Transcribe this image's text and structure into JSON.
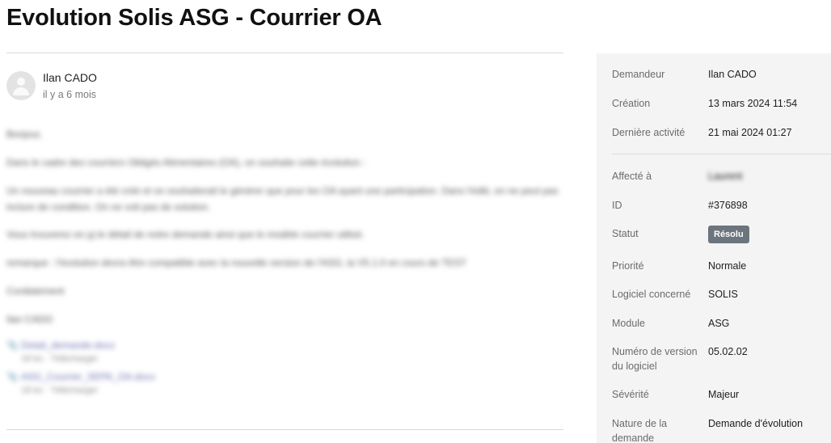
{
  "page": {
    "title": "Evolution Solis ASG - Courrier OA"
  },
  "post": {
    "author": "Ilan CADO",
    "time": "il y a 6 mois",
    "paragraphs": [
      "Bonjour,",
      "Dans le cadre des courriers Obligés Alimentaires (OA), on souhaite cette évolution :",
      "Un nouveau courrier a été créé et on souhaiterait le générer que pour les OA ayant une participation. Dans l'éditi, on ne peut pas inclure de condition. On ne voit pas de solution.",
      "Vous trouverez en pj le détail de notre demande ainsi que le modèle courrier utilisé.",
      "remarque : l'évolution devra être compatible avec la nouvelle version de l'ASG, la V5.1.0 en cours de TEST",
      "Cordialement",
      "Ilan CADO"
    ],
    "attachments": [
      {
        "name": "Detail_demande.docx",
        "meta": "18 ko · Télécharger"
      },
      {
        "name": "ASG_Courrier_SEPA_OA.docx",
        "meta": "18 ko · Télécharger"
      }
    ]
  },
  "sidebar": {
    "fields": [
      {
        "label": "Demandeur",
        "value": "Ilan CADO"
      },
      {
        "label": "Création",
        "value": "13 mars 2024 11:54"
      },
      {
        "label": "Dernière activité",
        "value": "21 mai 2024 01:27"
      },
      {
        "label": "Affecté à",
        "value": "Laurent"
      },
      {
        "label": "ID",
        "value": "#376898"
      },
      {
        "label": "Statut",
        "value": "Résolu"
      },
      {
        "label": "Priorité",
        "value": "Normale"
      },
      {
        "label": "Logiciel concerné",
        "value": "SOLIS"
      },
      {
        "label": "Module",
        "value": "ASG"
      },
      {
        "label": "Numéro de version du logiciel",
        "value": "05.02.02"
      },
      {
        "label": "Sévérité",
        "value": "Majeur"
      },
      {
        "label": "Nature de la demande",
        "value": "Demande d'évolution"
      }
    ],
    "status_color": "#6c757d"
  }
}
